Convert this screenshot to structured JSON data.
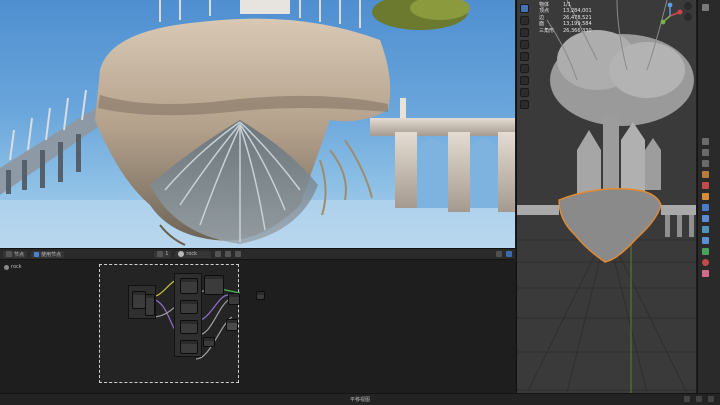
{
  "node_editor": {
    "editor_type": "节点",
    "use_nodes_label": "使用节点",
    "slot_label": "1",
    "material_name": "rock",
    "breadcrumb": "rock"
  },
  "viewport_stats": [
    {
      "key": "物体",
      "value": "1/1"
    },
    {
      "key": "顶点",
      "value": "13,284,001"
    },
    {
      "key": "边",
      "value": "26,478,521"
    },
    {
      "key": "面",
      "value": "13,199,584"
    },
    {
      "key": "三角形",
      "value": "26,366,330"
    }
  ],
  "status_bar": {
    "center_text": "平移视图"
  },
  "colors": {
    "accent_blue": "#4772b3",
    "selection_outline": "#e58a2e",
    "node_link_yellow": "#c9c93a",
    "node_link_purple": "#8e6fd0",
    "node_link_green": "#4fbf5a",
    "node_link_grey": "#a0a0a0"
  },
  "icons": {
    "toolbar": [
      "select-icon",
      "cursor-icon",
      "move-icon",
      "rotate-icon",
      "scale-icon",
      "transform-icon",
      "annotate-icon",
      "measure-icon",
      "add-cube-icon"
    ],
    "properties": [
      "tool-icon",
      "render-icon",
      "output-icon",
      "view-layer-icon",
      "scene-icon",
      "world-icon",
      "object-icon",
      "modifier-icon",
      "particles-icon",
      "physics-icon",
      "constraints-icon",
      "data-icon",
      "material-icon",
      "texture-icon"
    ]
  }
}
